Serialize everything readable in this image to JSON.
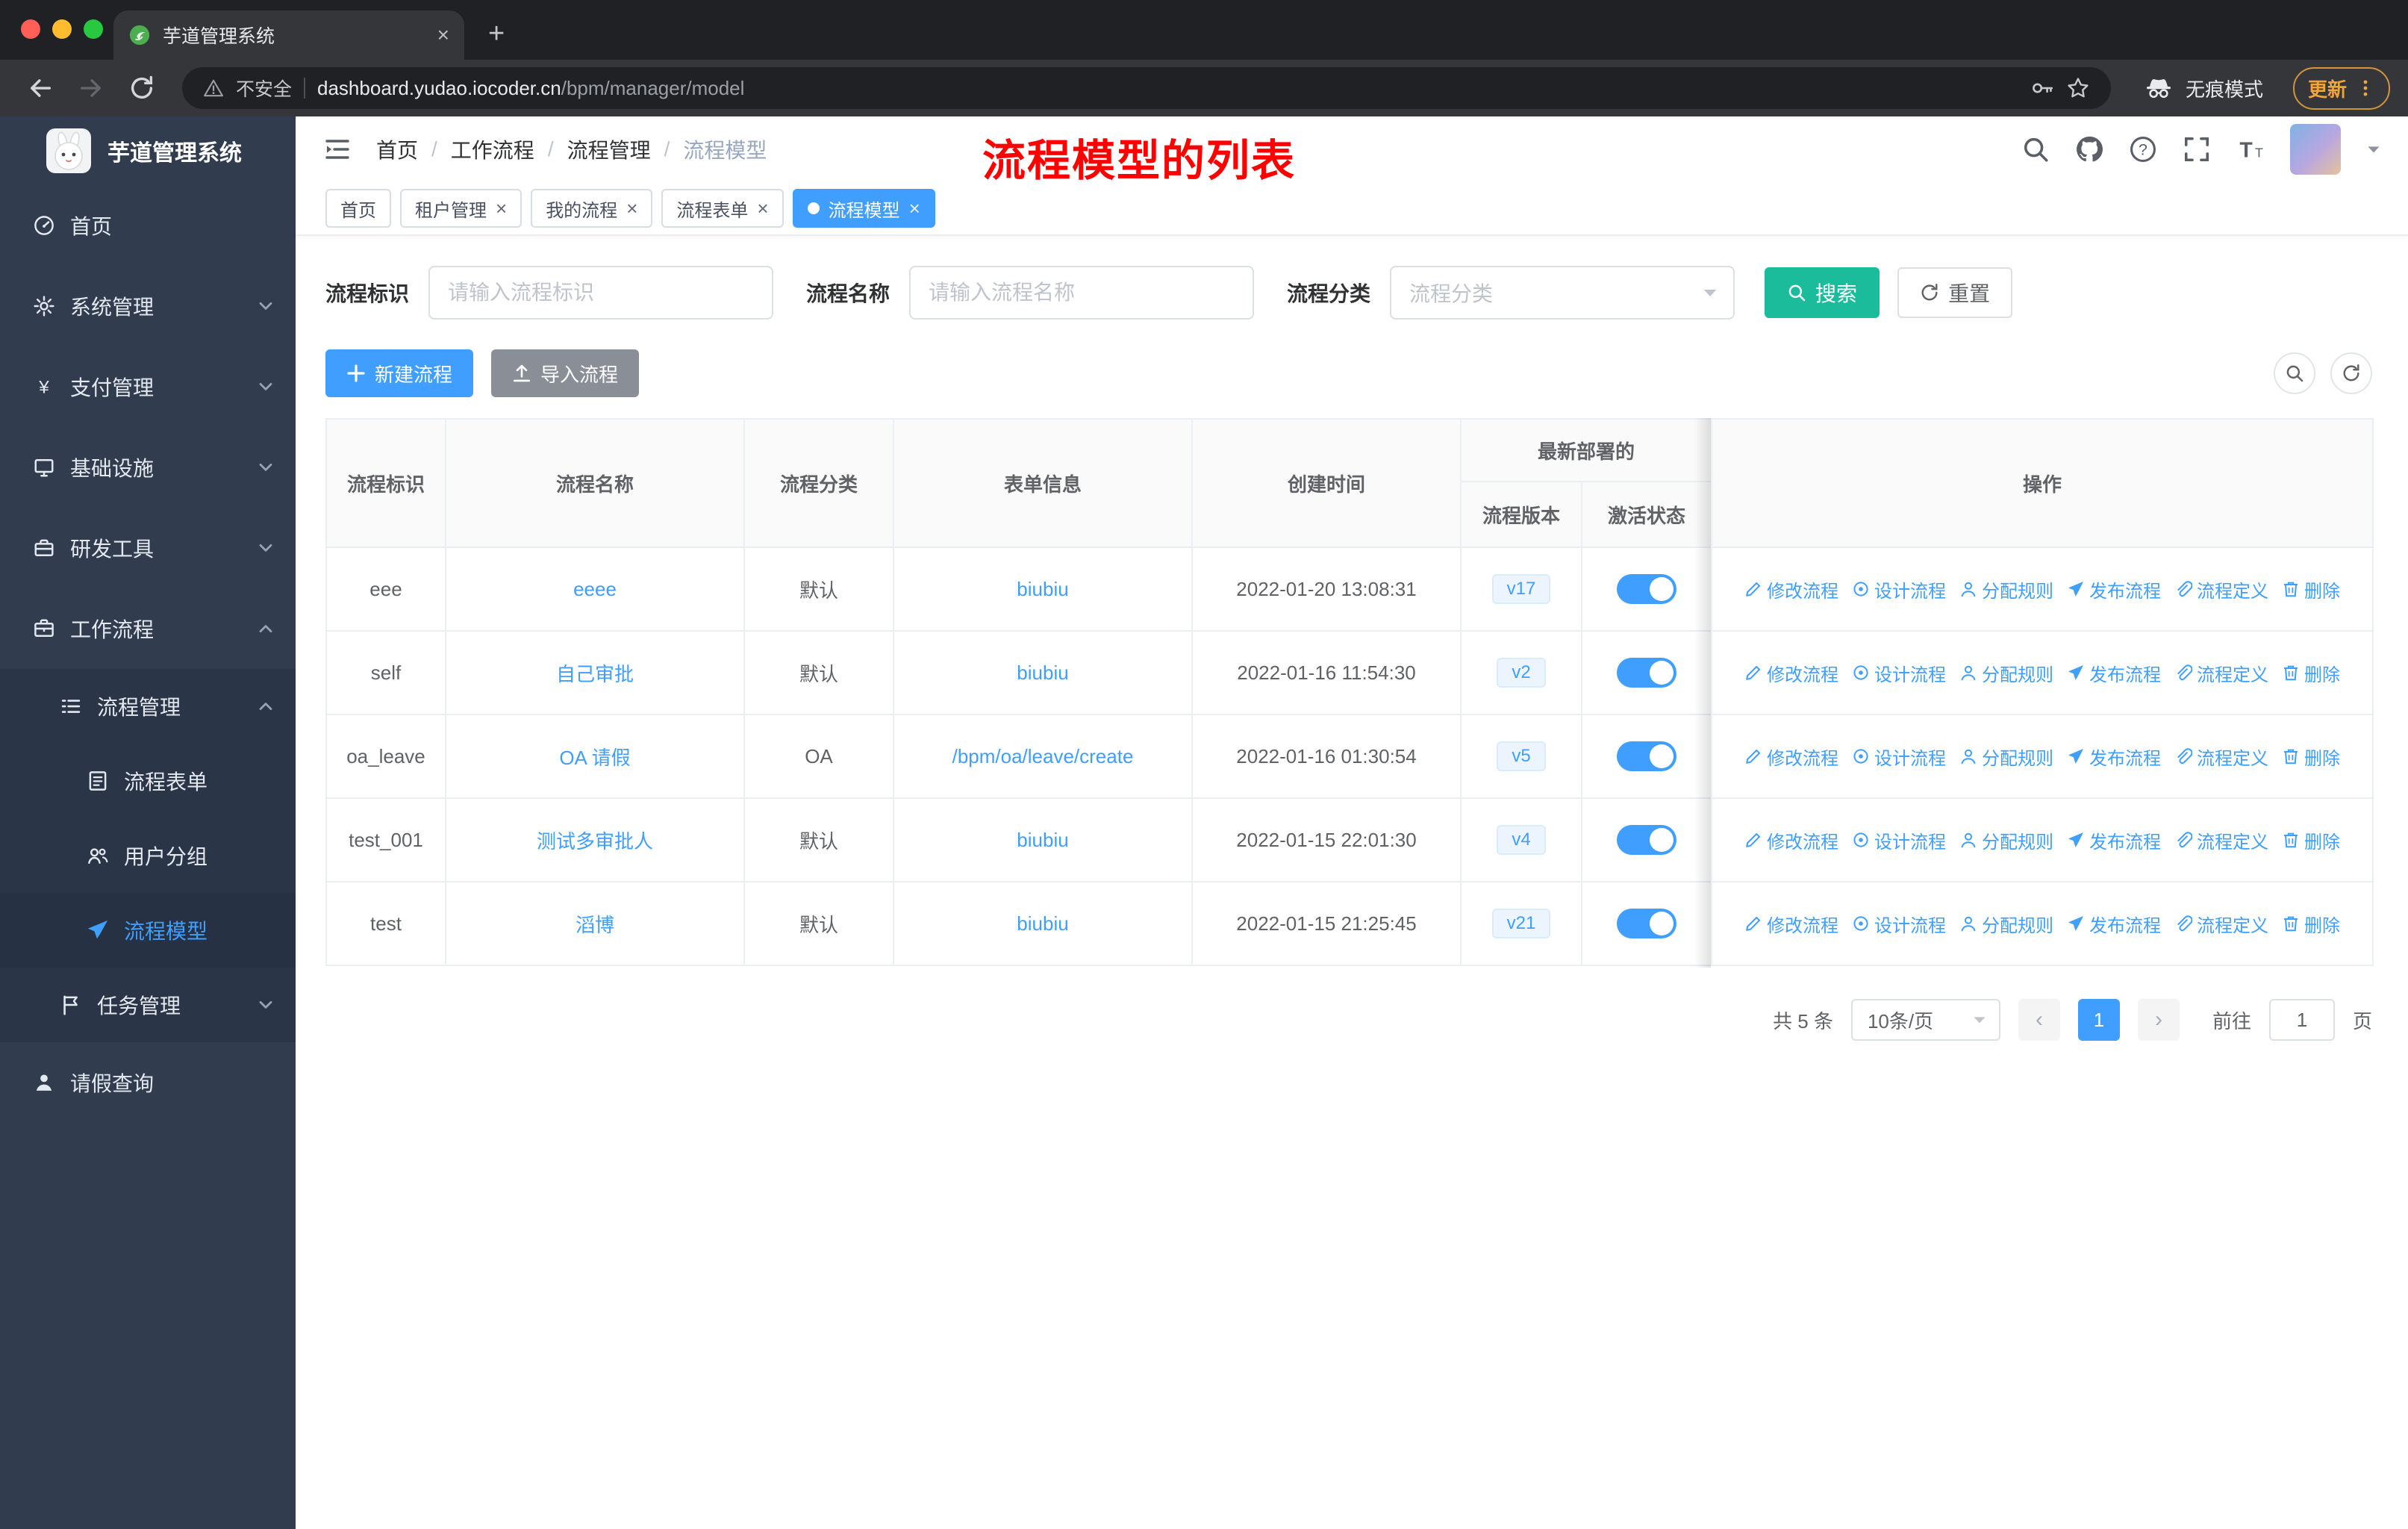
{
  "browser": {
    "tab": {
      "title": "芋道管理系统"
    },
    "security_label": "不安全",
    "url_domain": "dashboard.yudao.iocoder.cn",
    "url_path": "/bpm/manager/model",
    "incognito_label": "无痕模式",
    "update_label": "更新"
  },
  "sidebar": {
    "logo_title": "芋道管理系统",
    "menu": [
      {
        "key": "home",
        "label": "首页",
        "icon": "dashboard-icon",
        "level": 1
      },
      {
        "key": "system",
        "label": "系统管理",
        "icon": "gear-icon",
        "level": 1,
        "arrow": "down"
      },
      {
        "key": "payment",
        "label": "支付管理",
        "icon": "yen-icon",
        "level": 1,
        "arrow": "down"
      },
      {
        "key": "infrastructure",
        "label": "基础设施",
        "icon": "infra-icon",
        "level": 1,
        "arrow": "down"
      },
      {
        "key": "devtools",
        "label": "研发工具",
        "icon": "toolbox-icon",
        "level": 1,
        "arrow": "down"
      },
      {
        "key": "workflow",
        "label": "工作流程",
        "icon": "briefcase-icon",
        "level": 1,
        "arrow": "up"
      },
      {
        "key": "process-manage",
        "label": "流程管理",
        "icon": "list-icon",
        "level": 2,
        "arrow": "up",
        "submenu_bg": true
      },
      {
        "key": "process-form",
        "label": "流程表单",
        "icon": "document-icon",
        "level": 3,
        "submenu_bg": true
      },
      {
        "key": "user-group",
        "label": "用户分组",
        "icon": "users-icon",
        "level": 3,
        "submenu_bg": true
      },
      {
        "key": "process-model",
        "label": "流程模型",
        "icon": "paper-plane-icon",
        "level": 3,
        "submenu_bg": true,
        "active": true
      },
      {
        "key": "task-manage",
        "label": "任务管理",
        "icon": "flag-icon",
        "level": 2,
        "arrow": "down",
        "submenu_bg": true
      },
      {
        "key": "leave-query",
        "label": "请假查询",
        "icon": "user-icon",
        "level": 1
      }
    ]
  },
  "header": {
    "breadcrumb": [
      "首页",
      "工作流程",
      "流程管理",
      "流程模型"
    ],
    "annotation": "流程模型的列表"
  },
  "tags": [
    {
      "key": "home",
      "label": "首页",
      "closable": false,
      "active": false
    },
    {
      "key": "tenant",
      "label": "租户管理",
      "closable": true,
      "active": false
    },
    {
      "key": "my-process",
      "label": "我的流程",
      "closable": true,
      "active": false
    },
    {
      "key": "process-form",
      "label": "流程表单",
      "closable": true,
      "active": false
    },
    {
      "key": "process-model",
      "label": "流程模型",
      "closable": true,
      "active": true
    }
  ],
  "filters": {
    "id_label": "流程标识",
    "id_placeholder": "请输入流程标识",
    "name_label": "流程名称",
    "name_placeholder": "请输入流程名称",
    "category_label": "流程分类",
    "category_placeholder": "流程分类",
    "search_label": "搜索",
    "reset_label": "重置"
  },
  "toolbar": {
    "create_label": "新建流程",
    "import_label": "导入流程"
  },
  "table": {
    "group_header": "最新部署的",
    "columns": [
      "流程标识",
      "流程名称",
      "流程分类",
      "表单信息",
      "创建时间",
      "流程版本",
      "激活状态",
      "操作"
    ],
    "actions": [
      {
        "key": "modify",
        "label": "修改流程",
        "icon": "edit-icon"
      },
      {
        "key": "design",
        "label": "设计流程",
        "icon": "design-icon"
      },
      {
        "key": "assign",
        "label": "分配规则",
        "icon": "assign-icon"
      },
      {
        "key": "publish",
        "label": "发布流程",
        "icon": "publish-icon"
      },
      {
        "key": "definition",
        "label": "流程定义",
        "icon": "definition-icon"
      },
      {
        "key": "delete",
        "label": "删除",
        "icon": "delete-icon"
      }
    ],
    "rows": [
      {
        "id": "eee",
        "name": "eeee",
        "category": "默认",
        "form": "biubiu",
        "created": "2022-01-20 13:08:31",
        "version": "v17",
        "active": true
      },
      {
        "id": "self",
        "name": "自己审批",
        "category": "默认",
        "form": "biubiu",
        "created": "2022-01-16 11:54:30",
        "version": "v2",
        "active": true
      },
      {
        "id": "oa_leave",
        "name": "OA 请假",
        "category": "OA",
        "form": "/bpm/oa/leave/create",
        "created": "2022-01-16 01:30:54",
        "version": "v5",
        "active": true
      },
      {
        "id": "test_001",
        "name": "测试多审批人",
        "category": "默认",
        "form": "biubiu",
        "created": "2022-01-15 22:01:30",
        "version": "v4",
        "active": true
      },
      {
        "id": "test",
        "name": "滔博",
        "category": "默认",
        "form": "biubiu",
        "created": "2022-01-15 21:25:45",
        "version": "v21",
        "active": true
      }
    ]
  },
  "pagination": {
    "total": "共 5 条",
    "page_size": "10条/页",
    "current_page": "1",
    "goto_label": "前往",
    "goto_value": "1",
    "page_label": "页"
  },
  "colors": {
    "primary": "#409EFF",
    "search_button": "#1ABC9C",
    "annotation_red": "#FE0000",
    "sidebar_bg": "#313D4F",
    "submenu_bg": "#2A3547",
    "version_tag_bg": "#ECF5FF",
    "toggle_on": "#409EFF"
  }
}
